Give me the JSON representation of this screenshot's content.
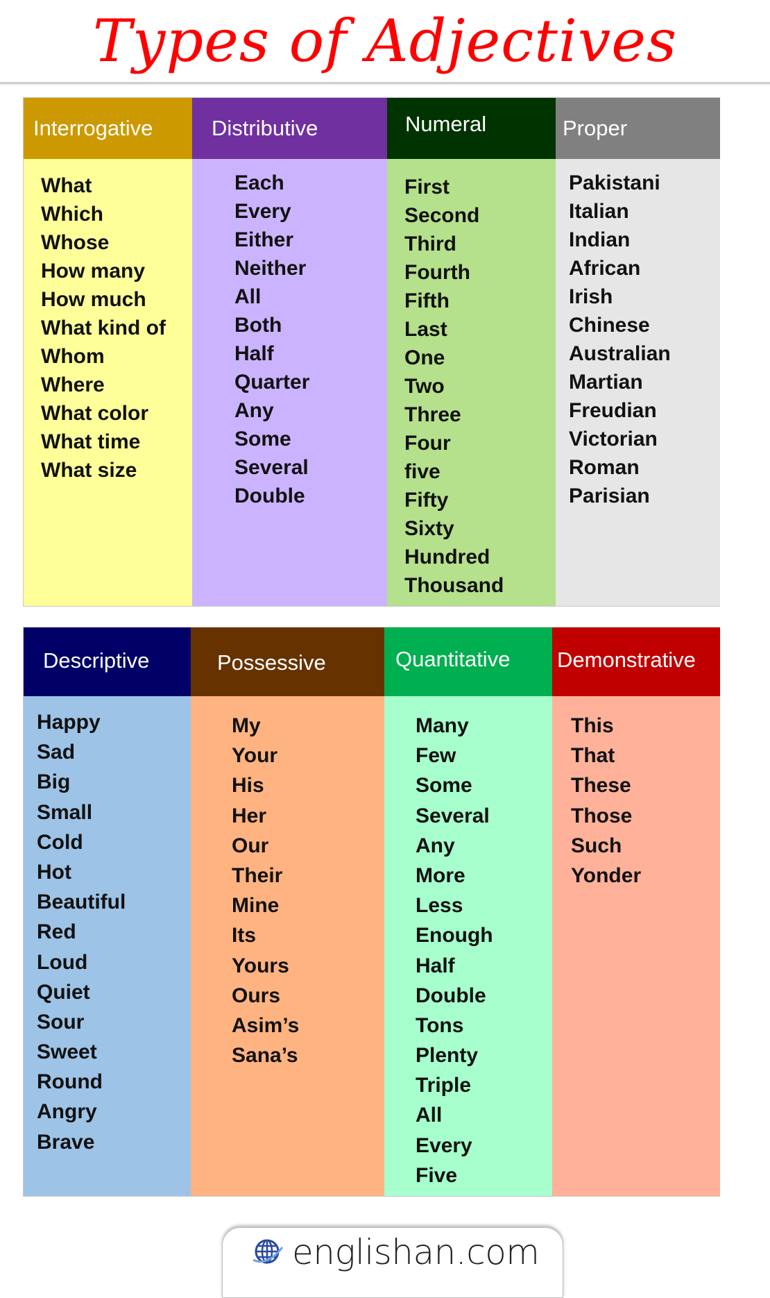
{
  "title": "Types of Adjectives",
  "colors": {
    "title": "#FF0000"
  },
  "top_table": [
    {
      "heading": "Interrogative",
      "header_color": "#CC9900",
      "body_color": "#FFFF99",
      "words": [
        "What",
        "Which",
        "Whose",
        "How many",
        "How much",
        "What kind of",
        "Whom",
        "Where",
        "What color",
        "What time",
        "What size"
      ]
    },
    {
      "heading": "Distributive",
      "header_color": "#7030A0",
      "body_color": "#CCB3FF",
      "words": [
        "Each",
        "Every",
        "Either",
        "Neither",
        "All",
        "Both",
        "Half",
        "Quarter",
        "Any",
        "Some",
        "Several",
        "Double"
      ]
    },
    {
      "heading": "Numeral",
      "header_color": "#003300",
      "body_color": "#B5E08C",
      "words": [
        "First",
        "Second",
        "Third",
        "Fourth",
        "Fifth",
        "Last",
        "One",
        "Two",
        "Three",
        "Four",
        "five",
        "Fifty",
        "Sixty",
        "Hundred",
        "Thousand"
      ]
    },
    {
      "heading": "Proper",
      "header_color": "#808080",
      "body_color": "#E6E6E6",
      "words": [
        "Pakistani",
        "Italian",
        "Indian",
        "African",
        "Irish",
        "Chinese",
        "Australian",
        "Martian",
        "Freudian",
        "Victorian",
        "Roman",
        "Parisian"
      ]
    }
  ],
  "bottom_table": [
    {
      "heading": "Descriptive",
      "header_color": "#000066",
      "body_color": "#9DC3E6",
      "words": [
        "Happy",
        "Sad",
        "Big",
        "Small",
        "Cold",
        "Hot",
        "Beautiful",
        "Red",
        "Loud",
        "Quiet",
        "Sour",
        "Sweet",
        "Round",
        "Angry",
        "Brave"
      ]
    },
    {
      "heading": "Possessive",
      "header_color": "#663300",
      "body_color": "#FFB381",
      "words": [
        "My",
        "Your",
        "His",
        "Her",
        "Our",
        "Their",
        "Mine",
        "Its",
        "Yours",
        "Ours",
        "Asim’s",
        "Sana’s"
      ]
    },
    {
      "heading": "Quantitative",
      "header_color": "#00AF50",
      "body_color": "#A6FFCC",
      "words": [
        "Many",
        "Few",
        "Some",
        "Several",
        "Any",
        "More",
        "Less",
        "Enough",
        "Half",
        "Double",
        "Tons",
        "Plenty",
        "Triple",
        "All",
        "Every",
        "Five"
      ]
    },
    {
      "heading": "Demonstrative",
      "header_color": "#C00000",
      "body_color": "#FFB199",
      "words": [
        "This",
        "That",
        "These",
        "Those",
        "Such",
        "Yonder"
      ]
    }
  ],
  "footer": {
    "site": "englishan.com",
    "icon": "globe-icon"
  }
}
